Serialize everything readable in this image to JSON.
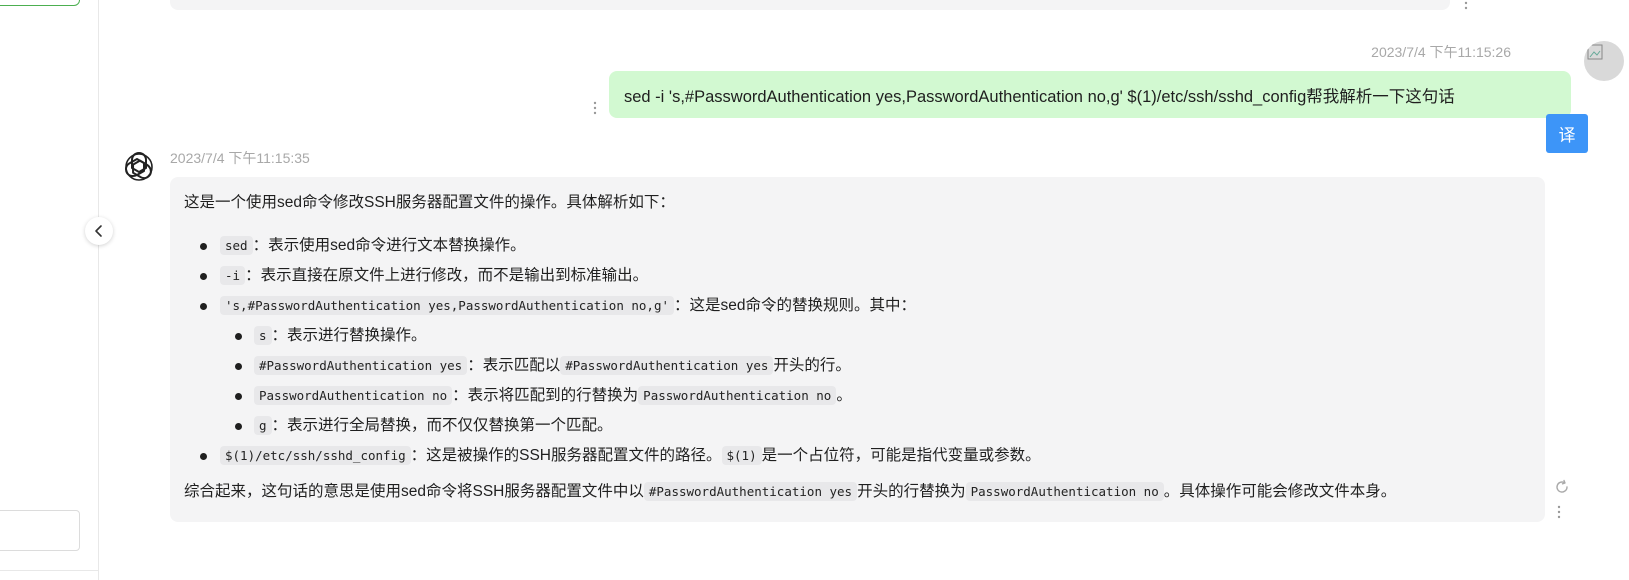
{
  "user_message": {
    "timestamp": "2023/7/4 下午11:15:26",
    "text": "sed -i 's,#PasswordAuthentication yes,PasswordAuthentication no,g' $(1)/etc/ssh/sshd_config帮我解析一下这句话",
    "translate_label": "译"
  },
  "assistant_message": {
    "timestamp": "2023/7/4 下午11:15:35",
    "intro": "这是一个使用sed命令修改SSH服务器配置文件的操作。具体解析如下：",
    "items": [
      {
        "code": "sed",
        "text": "：表示使用sed命令进行文本替换操作。"
      },
      {
        "code": "-i",
        "text": "：表示直接在原文件上进行修改，而不是输出到标准输出。"
      },
      {
        "code": "'s,#PasswordAuthentication yes,PasswordAuthentication no,g'",
        "text": "：这是sed命令的替换规则。其中："
      },
      {
        "code": "$(1)/etc/ssh/sshd_config",
        "text": "：这是被操作的SSH服务器配置文件的路径。",
        "code2": "$(1)",
        "text2": "是一个占位符，可能是指代变量或参数。"
      }
    ],
    "subitems": [
      {
        "code": "s",
        "text": "：表示进行替换操作。"
      },
      {
        "code": "#PasswordAuthentication yes",
        "text": "：表示匹配以",
        "code2": "#PasswordAuthentication yes",
        "text2": "开头的行。"
      },
      {
        "code": "PasswordAuthentication no",
        "text": "：表示将匹配到的行替换为",
        "code2": "PasswordAuthentication no",
        "text2": "。"
      },
      {
        "code": "g",
        "text": "：表示进行全局替换，而不仅仅替换第一个匹配。"
      }
    ],
    "summary": {
      "text1": "综合起来，这句话的意思是使用sed命令将SSH服务器配置文件中以",
      "code1": "#PasswordAuthentication yes",
      "text2": "开头的行替换为",
      "code2": "PasswordAuthentication no",
      "text3": "。具体操作可能会修改文件本身。"
    }
  },
  "icons": {
    "collapse": "chevron-left-icon",
    "more": "more-vertical-icon",
    "refresh": "refresh-icon",
    "assistant_avatar": "openai-logo-icon"
  },
  "colors": {
    "user_bubble": "#d2f9d1",
    "assistant_bubble": "#f4f4f5",
    "translate_button": "#3d95f8"
  }
}
